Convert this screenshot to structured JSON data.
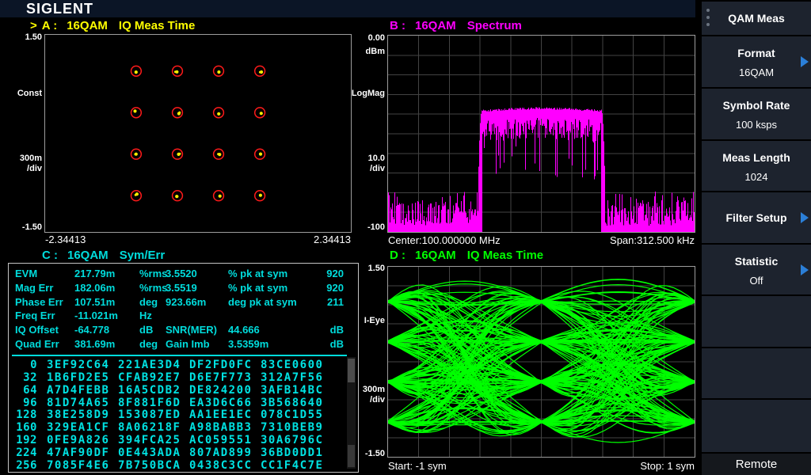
{
  "brand": "SIGLENT",
  "panel_a": {
    "indicator": ">",
    "id": "A :",
    "format": "16QAM",
    "view": "IQ Meas Time",
    "y_top": "1.50",
    "y_mid": "Const",
    "y_div_val": "300m",
    "y_div_unit": "/div",
    "y_bot": "-1.50",
    "x_left": "-2.34413",
    "x_right": "2.34413"
  },
  "panel_b": {
    "id": "B :",
    "format": "16QAM",
    "view": "Spectrum",
    "y_top": "0.00",
    "y_top_unit": "dBm",
    "y_mid": "LogMag",
    "y_div_val": "10.0",
    "y_div_unit": "/div",
    "y_bot": "-100",
    "footer_left": "Center:100.000000 MHz",
    "footer_right": "Span:312.500 kHz"
  },
  "panel_c": {
    "id": "C :",
    "format": "16QAM",
    "view": "Sym/Err",
    "metrics": [
      [
        "EVM",
        "217.79m",
        "%rms",
        "3.5520",
        "% pk at sym",
        "920"
      ],
      [
        "Mag Err",
        "182.06m",
        "%rms",
        "3.5519",
        "% pk at sym",
        "920"
      ],
      [
        "Phase Err",
        "107.51m",
        "deg",
        "923.66m",
        "deg pk at sym",
        "211"
      ],
      [
        "Freq Err",
        "-11.021m",
        "Hz",
        "",
        "",
        ""
      ],
      [
        "IQ Offset",
        "-64.778",
        "dB",
        "SNR(MER)",
        "44.666",
        "dB"
      ],
      [
        "Quad Err",
        "381.69m",
        "deg",
        "Gain Imb",
        "3.5359m",
        "dB"
      ]
    ],
    "hex_rows": [
      {
        "offset": "0",
        "groups": [
          "3EF92C64",
          "221AE3D4",
          "DF2FD0FC",
          "83CE0600"
        ]
      },
      {
        "offset": "32",
        "groups": [
          "1B6FD2E5",
          "CFAB92E7",
          "D6E7F773",
          "312A7F56"
        ]
      },
      {
        "offset": "64",
        "groups": [
          "A7D4FEBB",
          "16A5CDB2",
          "DE824200",
          "3AFB14BC"
        ]
      },
      {
        "offset": "96",
        "groups": [
          "81D74A65",
          "8F881F6D",
          "EA3D6C66",
          "3B568640"
        ]
      },
      {
        "offset": "128",
        "groups": [
          "38E258D9",
          "153087ED",
          "AA1EE1EC",
          "078C1D55"
        ]
      },
      {
        "offset": "160",
        "groups": [
          "329EA1CF",
          "8A06218F",
          "A98BABB3",
          "7310BEB9"
        ]
      },
      {
        "offset": "192",
        "groups": [
          "0FE9A826",
          "394FCA25",
          "AC059551",
          "30A6796C"
        ]
      },
      {
        "offset": "224",
        "groups": [
          "47AF90DF",
          "0E443ADA",
          "807AD899",
          "36BD0DD1"
        ]
      },
      {
        "offset": "256",
        "groups": [
          "7085F4E6",
          "7B750BCA",
          "0438C3CC",
          "CC1F4C7E"
        ]
      }
    ]
  },
  "panel_d": {
    "id": "D :",
    "format": "16QAM",
    "view": "IQ Meas Time",
    "y_top": "1.50",
    "y_mid": "I-Eye",
    "y_div_val": "300m",
    "y_div_unit": "/div",
    "y_bot": "-1.50",
    "footer_left": "Start: -1 sym",
    "footer_right": "Stop: 1 sym"
  },
  "sidebar": {
    "items": [
      {
        "label": "QAM Meas",
        "value": ""
      },
      {
        "label": "Format",
        "value": "16QAM"
      },
      {
        "label": "Symbol Rate",
        "value": "100 ksps"
      },
      {
        "label": "Meas Length",
        "value": "1024"
      },
      {
        "label": "Filter Setup",
        "value": ""
      },
      {
        "label": "Statistic",
        "value": "Off"
      },
      {
        "label": "",
        "value": ""
      },
      {
        "label": "",
        "value": ""
      },
      {
        "label": "",
        "value": ""
      }
    ],
    "remote_label": "Remote"
  },
  "colors": {
    "accent_yellow": "#ffff00",
    "accent_magenta": "#ff00ff",
    "accent_cyan": "#00dcdc",
    "accent_green": "#00ff00",
    "arrow_blue": "#2b7fd8",
    "constellation_circle": "#ff1a1a",
    "constellation_dot": "#ffee00"
  }
}
